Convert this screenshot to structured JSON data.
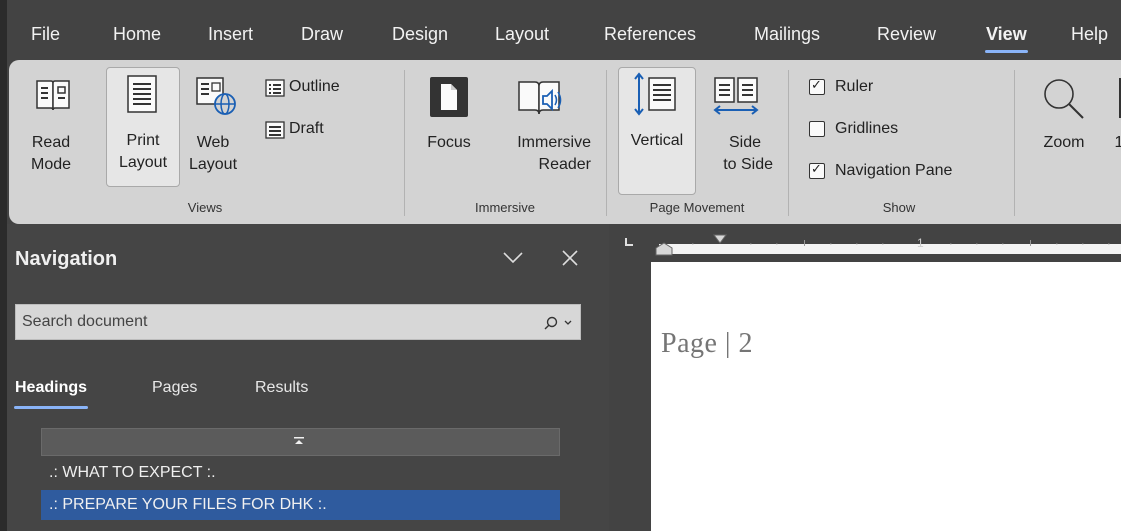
{
  "menu": {
    "items": [
      "File",
      "Home",
      "Insert",
      "Draw",
      "Design",
      "Layout",
      "References",
      "Mailings",
      "Review",
      "View",
      "Help"
    ],
    "active": "View"
  },
  "ribbon": {
    "views": {
      "read_mode": [
        "Read",
        "Mode"
      ],
      "print_layout": [
        "Print",
        "Layout"
      ],
      "web_layout": [
        "Web",
        "Layout"
      ],
      "outline": "Outline",
      "draft": "Draft",
      "group_label": "Views"
    },
    "immersive": {
      "focus": "Focus",
      "immersive_reader": [
        "Immersive",
        "Reader"
      ],
      "group_label": "Immersive"
    },
    "page_movement": {
      "vertical": "Vertical",
      "side_to_side": [
        "Side",
        "to Side"
      ],
      "group_label": "Page Movement"
    },
    "show": {
      "ruler": {
        "label": "Ruler",
        "checked": true
      },
      "gridlines": {
        "label": "Gridlines",
        "checked": false
      },
      "navigation_pane": {
        "label": "Navigation Pane",
        "checked": true
      },
      "group_label": "Show"
    },
    "zoom": {
      "zoom": "Zoom",
      "partial": "1"
    }
  },
  "navigation": {
    "title": "Navigation",
    "search_placeholder": "Search document",
    "tabs": [
      "Headings",
      "Pages",
      "Results"
    ],
    "active_tab": "Headings",
    "headings": [
      {
        "text": ".: WHAT TO EXPECT :.",
        "selected": false
      },
      {
        "text": ".: PREPARE YOUR FILES FOR DHK :.",
        "selected": true
      }
    ]
  },
  "ruler": {
    "mark": "1"
  },
  "document": {
    "page_text": "Page | 2"
  },
  "colors": {
    "accent": "#8ab4f8",
    "selection": "#2f5b9e",
    "ribbon": "#d3d3d3",
    "chrome": "#434343"
  }
}
